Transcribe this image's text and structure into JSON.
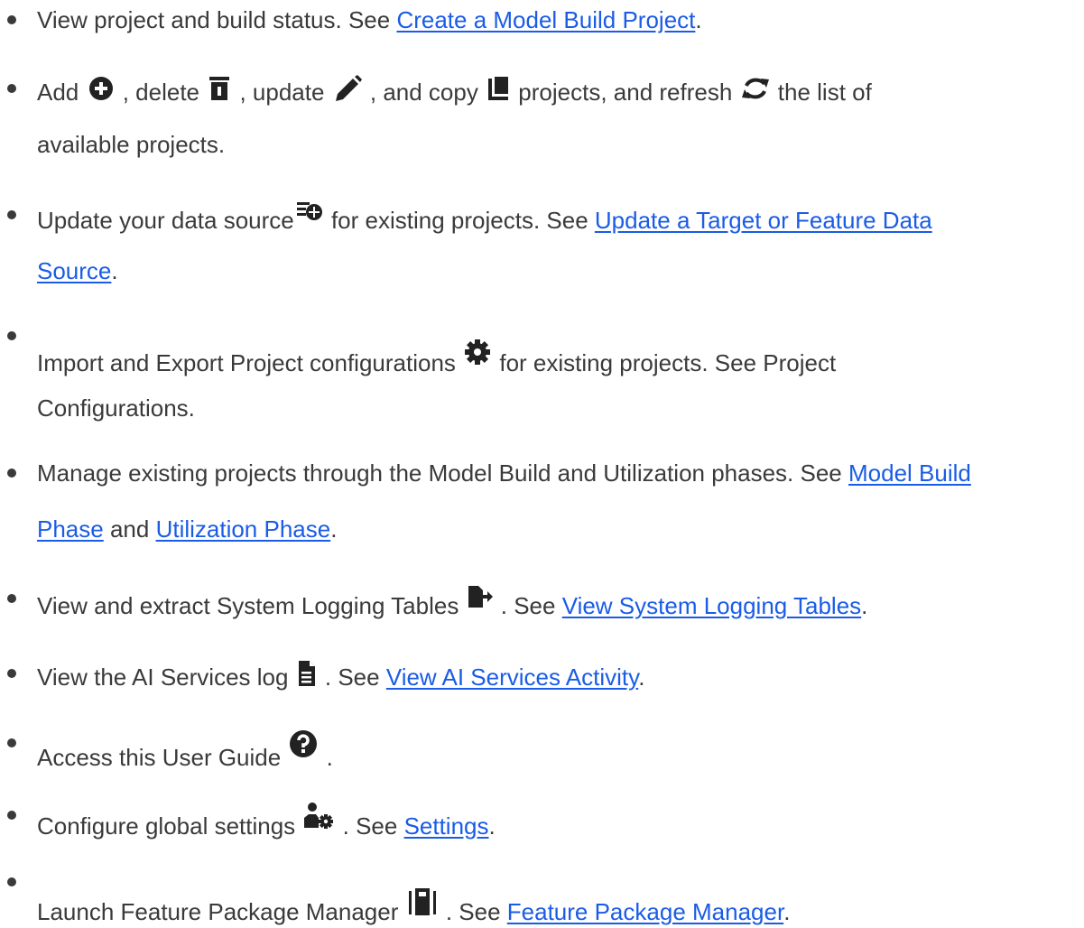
{
  "items": [
    {
      "t1": "View project and build status. See ",
      "link1": "Create a Model Build Project",
      "t2": "."
    },
    {
      "t1": "Add ",
      "t2": " , delete ",
      "t3": " , update ",
      "t4": " , and copy ",
      "t5": "  projects, and refresh ",
      "t6": "  the list of",
      "t7": "available projects.",
      "icons": [
        "add-circle-icon",
        "trash-icon",
        "pencil-icon",
        "copy-icon",
        "refresh-icon"
      ]
    },
    {
      "t1": "Update your data source",
      "t2": "  for existing projects. See ",
      "link1a": "Update a Target or Feature Data",
      "link1b": "Source",
      "t3": ".",
      "icons": [
        "data-source-icon"
      ]
    },
    {
      "t1": "Import and Export Project configurations ",
      "t2": "  for existing projects. See Project",
      "t3": "Configurations.",
      "icons": [
        "gear-icon"
      ]
    },
    {
      "t1": "Manage existing projects through the Model Build and Utilization phases. See ",
      "link1a": "Model Build",
      "link1b": "Phase",
      "t2": " and ",
      "link2": "Utilization Phase",
      "t3": "."
    },
    {
      "t1": "View and extract System Logging Tables ",
      "t2": "  . See ",
      "link1": "View System Logging Tables",
      "t3": ".",
      "icons": [
        "export-log-icon"
      ]
    },
    {
      "t1": "View the AI Services log ",
      "t2": " . See ",
      "link1": "View AI Services Activity",
      "t3": ".",
      "icons": [
        "document-icon"
      ]
    },
    {
      "t1": "Access this User Guide ",
      "t2": " .",
      "icons": [
        "help-circle-icon"
      ]
    },
    {
      "t1": " Configure global settings ",
      "t2": " . See ",
      "link1": "Settings",
      "t3": ".",
      "icons": [
        "user-settings-icon"
      ]
    },
    {
      "t1": "Launch Feature Package Manager ",
      "t2": " . See ",
      "link1": "Feature Package Manager",
      "t3": ".",
      "icons": [
        "package-manager-icon"
      ]
    }
  ],
  "colors": {
    "text": "#3a3a3a",
    "link": "#1a5ce6",
    "icon": "#222222"
  }
}
